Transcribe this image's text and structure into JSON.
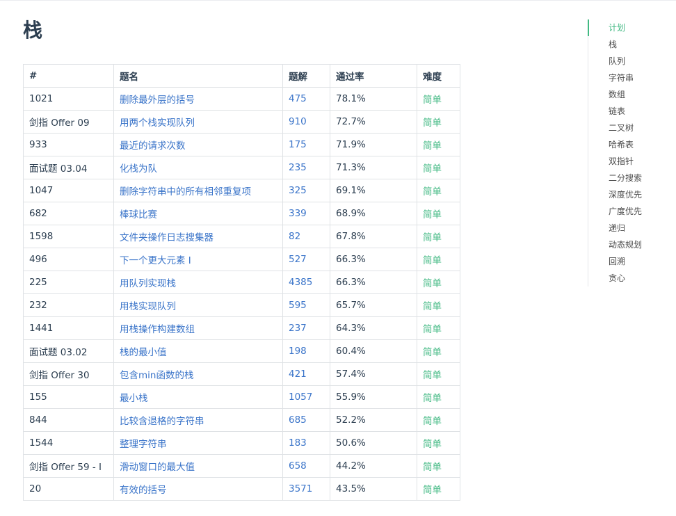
{
  "title": "栈",
  "table": {
    "headers": [
      "#",
      "题名",
      "题解",
      "通过率",
      "难度"
    ],
    "rows": [
      {
        "id": "1021",
        "name": "删除最外层的括号",
        "solutions": "475",
        "rate": "78.1%",
        "difficulty": "简单"
      },
      {
        "id": "剑指 Offer 09",
        "name": "用两个栈实现队列",
        "solutions": "910",
        "rate": "72.7%",
        "difficulty": "简单"
      },
      {
        "id": "933",
        "name": "最近的请求次数",
        "solutions": "175",
        "rate": "71.9%",
        "difficulty": "简单"
      },
      {
        "id": "面试题 03.04",
        "name": "化栈为队",
        "solutions": "235",
        "rate": "71.3%",
        "difficulty": "简单"
      },
      {
        "id": "1047",
        "name": "删除字符串中的所有相邻重复项",
        "solutions": "325",
        "rate": "69.1%",
        "difficulty": "简单"
      },
      {
        "id": "682",
        "name": "棒球比赛",
        "solutions": "339",
        "rate": "68.9%",
        "difficulty": "简单"
      },
      {
        "id": "1598",
        "name": "文件夹操作日志搜集器",
        "solutions": "82",
        "rate": "67.8%",
        "difficulty": "简单"
      },
      {
        "id": "496",
        "name": "下一个更大元素 I",
        "solutions": "527",
        "rate": "66.3%",
        "difficulty": "简单"
      },
      {
        "id": "225",
        "name": "用队列实现栈",
        "solutions": "4385",
        "rate": "66.3%",
        "difficulty": "简单"
      },
      {
        "id": "232",
        "name": "用栈实现队列",
        "solutions": "595",
        "rate": "65.7%",
        "difficulty": "简单"
      },
      {
        "id": "1441",
        "name": "用栈操作构建数组",
        "solutions": "237",
        "rate": "64.3%",
        "difficulty": "简单"
      },
      {
        "id": "面试题 03.02",
        "name": "栈的最小值",
        "solutions": "198",
        "rate": "60.4%",
        "difficulty": "简单"
      },
      {
        "id": "剑指 Offer 30",
        "name": "包含min函数的栈",
        "solutions": "421",
        "rate": "57.4%",
        "difficulty": "简单"
      },
      {
        "id": "155",
        "name": "最小栈",
        "solutions": "1057",
        "rate": "55.9%",
        "difficulty": "简单"
      },
      {
        "id": "844",
        "name": "比较含退格的字符串",
        "solutions": "685",
        "rate": "52.2%",
        "difficulty": "简单"
      },
      {
        "id": "1544",
        "name": "整理字符串",
        "solutions": "183",
        "rate": "50.6%",
        "difficulty": "简单"
      },
      {
        "id": "剑指 Offer 59 - I",
        "name": "滑动窗口的最大值",
        "solutions": "658",
        "rate": "44.2%",
        "difficulty": "简单"
      },
      {
        "id": "20",
        "name": "有效的括号",
        "solutions": "3571",
        "rate": "43.5%",
        "difficulty": "简单"
      }
    ]
  },
  "toc": {
    "active_index": 0,
    "items": [
      "计划",
      "栈",
      "队列",
      "字符串",
      "数组",
      "链表",
      "二叉树",
      "哈希表",
      "双指针",
      "二分搜索",
      "深度优先",
      "广度优先",
      "递归",
      "动态规划",
      "回溯",
      "贪心"
    ]
  },
  "colors": {
    "link": "#3a74c9",
    "easy": "#42b983",
    "toc_active": "#42b983",
    "border": "#dfe2e5"
  }
}
